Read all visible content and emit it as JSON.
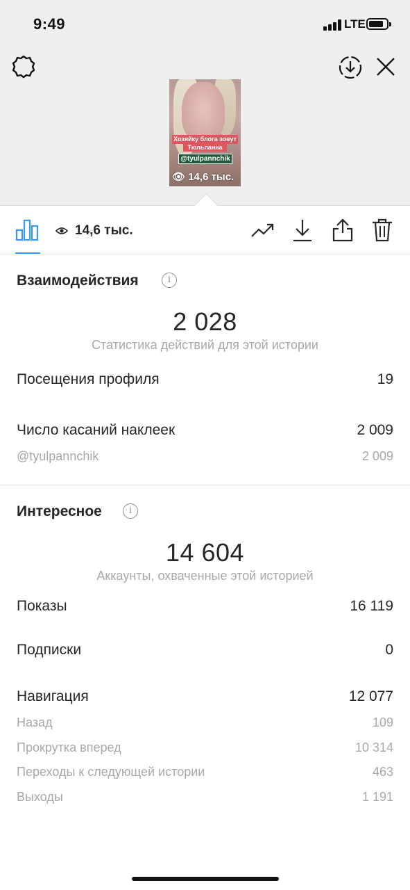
{
  "status_bar": {
    "time": "9:49",
    "network": "LTE"
  },
  "story_preview": {
    "caption_line1": "Хозяйку блога зовут",
    "caption_line2": "Тюльпанна",
    "mention": "@tyulpannchik",
    "views": "14,6 тыс."
  },
  "toolbar": {
    "views": "14,6 тыс."
  },
  "interactions": {
    "title": "Взаимодействия",
    "total": "2 028",
    "caption": "Статистика действий для этой истории",
    "rows": [
      {
        "label": "Посещения профиля",
        "value": "19"
      },
      {
        "label": "Число касаний наклеек",
        "value": "2 009"
      }
    ],
    "sub_rows": [
      {
        "label": "@tyulpannchik",
        "value": "2 009"
      }
    ]
  },
  "discovery": {
    "title": "Интересное",
    "total": "14 604",
    "caption": "Аккаунты, охваченные этой историей",
    "rows": [
      {
        "label": "Показы",
        "value": "16 119"
      },
      {
        "label": "Подписки",
        "value": "0"
      },
      {
        "label": "Навигация",
        "value": "12 077"
      }
    ],
    "sub_rows": [
      {
        "label": "Назад",
        "value": "109"
      },
      {
        "label": "Прокрутка вперед",
        "value": "10 314"
      },
      {
        "label": "Переходы к следующей истории",
        "value": "463"
      },
      {
        "label": "Выходы",
        "value": "1 191"
      }
    ]
  },
  "colors": {
    "accent": "#3897f0",
    "muted": "#a8a8a8",
    "text": "#262626",
    "header_bg": "#efefef"
  }
}
